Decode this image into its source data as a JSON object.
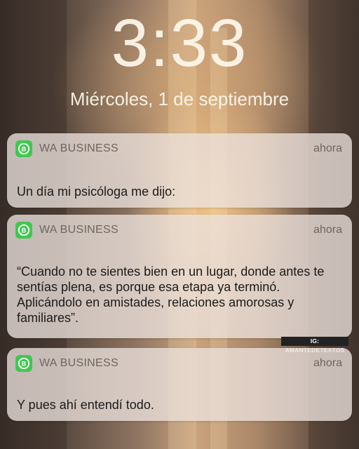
{
  "lock_screen": {
    "time": "3:33",
    "date": "Miércoles, 1 de septiembre"
  },
  "notifications": [
    {
      "app_name": "WA BUSINESS",
      "time": "ahora",
      "icon": "whatsapp-business-icon",
      "message": "Un día mi psicóloga me dijo:"
    },
    {
      "app_name": "WA BUSINESS",
      "time": "ahora",
      "icon": "whatsapp-business-icon",
      "message": "“Cuando no te sientes bien en un lugar, donde antes te sentías plena, es porque esa etapa ya terminó. Aplicándolo en amistades, relaciones amorosas y familiares”."
    },
    {
      "app_name": "WA BUSINESS",
      "time": "ahora",
      "icon": "whatsapp-business-icon",
      "message": "Y pues ahí entendí todo."
    }
  ],
  "watermark": "IG: AMANTEDETEXTOS",
  "colors": {
    "app_icon": "#3fc84f",
    "card_bg": "rgba(236,226,220,0.78)"
  }
}
